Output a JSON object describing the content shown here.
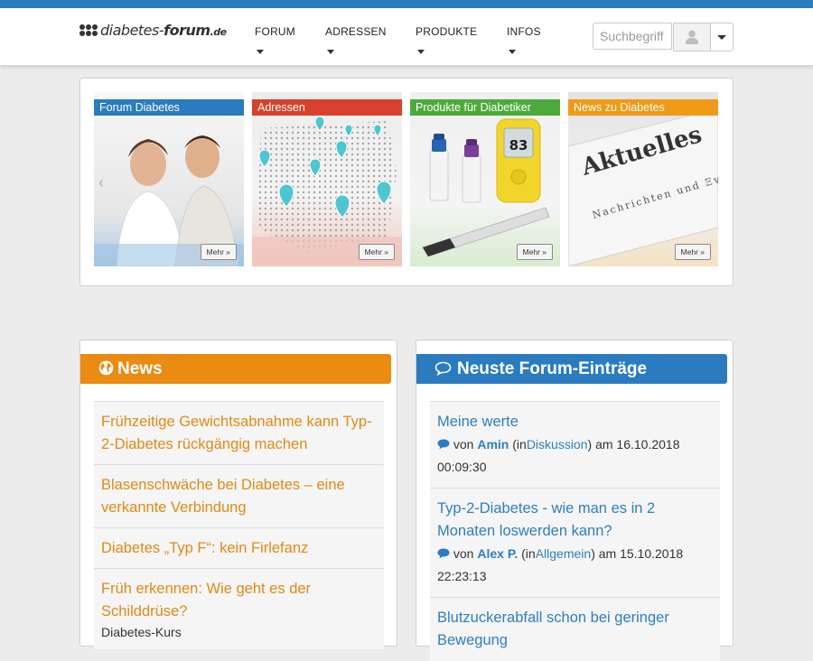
{
  "site": {
    "logo_main": "diabetes-",
    "logo_bold": "forum",
    "logo_tld": ".de"
  },
  "nav": {
    "items": [
      {
        "label": "FORUM"
      },
      {
        "label": "ADRESSEN"
      },
      {
        "label": "PRODUKTE"
      },
      {
        "label": "INFOS"
      }
    ],
    "search_placeholder": "Suchbegriff"
  },
  "slider": {
    "tiles": [
      {
        "title": "Forum Diabetes",
        "more": "Mehr »",
        "color": "#2a7bbf"
      },
      {
        "title": "Adressen",
        "more": "Mehr »",
        "color": "#d9402e"
      },
      {
        "title": "Produkte für Diabetiker",
        "more": "Mehr »",
        "color": "#4caa3c"
      },
      {
        "title": "News zu Diabetes",
        "more": "Mehr »",
        "color": "#f09a16"
      }
    ],
    "prev_icon": "chevron-left-icon",
    "next_icon": "chevron-right-icon",
    "tile3_display": "83",
    "tile4_headline": "Aktuelles",
    "tile4_subline": "Nachrichten und Eve"
  },
  "news": {
    "title": "News",
    "icon": "globe-icon",
    "color": "#ea8b12",
    "items": [
      {
        "title": "Frühzeitige Gewichtsabnahme kann Typ-2-Diabetes rückgängig machen"
      },
      {
        "title": "Blasenschwäche bei Diabetes – eine verkannte Verbindung"
      },
      {
        "title": "Diabetes „Typ F“: kein Firlefanz"
      },
      {
        "title": "Früh erkennen: Wie geht es der Schilddrüse?",
        "sub": "Diabetes-Kurs"
      }
    ]
  },
  "forum": {
    "title": "Neuste Forum-Einträge",
    "icon": "comment-icon",
    "color": "#2a7bbf",
    "items": [
      {
        "title": "Meine werte",
        "von": "von",
        "author": "Amin",
        "in": "(in",
        "category": "Diskussion",
        "am": ") am 16.10.2018",
        "time": "00:09:30"
      },
      {
        "title": "Typ-2-Diabetes - wie man es in 2 Monaten loswerden kann?",
        "von": "von",
        "author": "Alex P.",
        "in": "(in",
        "category": "Allgemein",
        "am": ") am 15.10.2018",
        "time": "22:23:13"
      },
      {
        "title": "Blutzuckerabfall schon bei geringer Bewegung"
      }
    ]
  }
}
